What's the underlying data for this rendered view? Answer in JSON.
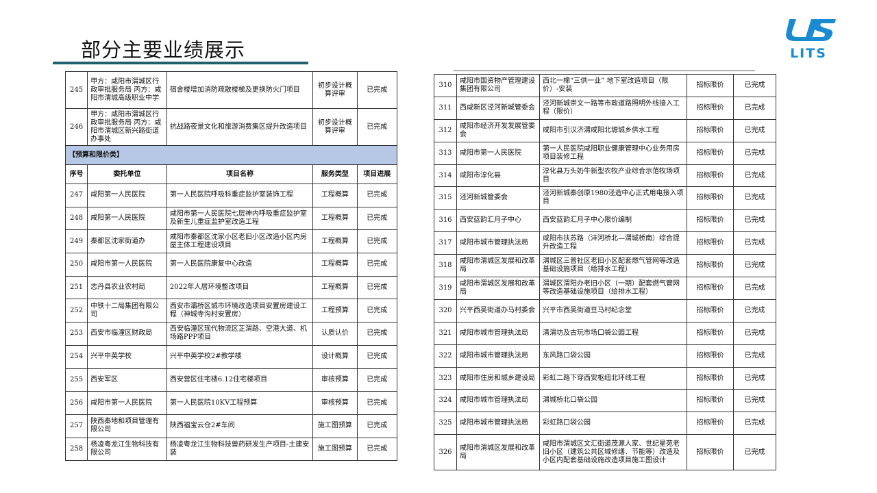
{
  "header": {
    "title": "部分主要业绩展示"
  },
  "logo": {
    "name": "lits-logo",
    "text": "LITS",
    "color": "#1a8bd0"
  },
  "left_table": {
    "top_rows": [
      {
        "no": "245",
        "unit": "甲方：咸阳市渭城区行政审批服务局\n丙方：咸阳市渭城高级职业中学",
        "project": "宿舍楼增加消防疏散楼梯及更换防火门项目",
        "service": "初步设计概算评审",
        "status": "已完成"
      },
      {
        "no": "246",
        "unit": "甲方：咸阳市渭城区行政审批服务局\n丙方：咸阳市渭城区新兴路街道办事处",
        "project": "抗战路夜景文化和旅游消费集区提升改造项目",
        "service": "初步设计概算评审",
        "status": "已完成"
      }
    ],
    "section_label": "【预算和限价类】",
    "headers": {
      "no": "序号",
      "unit": "委托单位",
      "project": "项目名称",
      "service": "服务类型",
      "status": "项目进展"
    },
    "rows": [
      {
        "no": "247",
        "unit": "咸阳第一人民医院",
        "project": "第一人民医院呼吸科重症监护室装饰工程",
        "service": "工程概算",
        "status": "已完成"
      },
      {
        "no": "248",
        "unit": "咸阳第一人民医院",
        "project": "咸阳市第一人民医院七层神内呼吸重症监护室及新生儿重症监护室改造工程",
        "service": "工程概算",
        "status": "已完成"
      },
      {
        "no": "249",
        "unit": "秦都区沈家街道办",
        "project": "咸阳市秦都区沈家小区老旧小区改造小区内房屋主体工程建设项目",
        "service": "工程概算",
        "status": "已完成"
      },
      {
        "no": "250",
        "unit": "咸阳市第一人民医院",
        "project": "第一人民医院康复中心改造",
        "service": "工程概算",
        "status": "已完成"
      },
      {
        "no": "251",
        "unit": "志丹县农业农村局",
        "project": "2022年人居环境整改项目",
        "service": "工程概算",
        "status": "已完成"
      },
      {
        "no": "252",
        "unit": "中铁十二局集团有限公司",
        "project": "西安市灞桥区城市环境改造项目安置房建设工程（神城寺沟村安置房）",
        "service": "工程预算",
        "status": "已完成"
      },
      {
        "no": "253",
        "unit": "西安市临潼区财政局",
        "project": "西安临潼区现代物流区芷渭路、空港大道、机场路PPP项目",
        "service": "认质认价",
        "status": "已完成"
      },
      {
        "no": "254",
        "unit": "兴平中英学校",
        "project": "兴平中英学校2#教学楼",
        "service": "设计概算",
        "status": "已完成"
      },
      {
        "no": "255",
        "unit": "西安军区",
        "project": "西安营区住宅楼6.12住宅楼项目",
        "service": "审核预算",
        "status": "已完成"
      },
      {
        "no": "256",
        "unit": "咸阳市第一人民医院",
        "project": "第一人民医院10KV工程预算",
        "service": "审核预算",
        "status": "已完成"
      },
      {
        "no": "257",
        "unit": "陕西秦地和项目管理有限公司",
        "project": "陕西福宝云仓2#车间",
        "service": "施工图预算",
        "status": "已完成"
      },
      {
        "no": "258",
        "unit": "杨凌粤龙江生物科技有限公司",
        "project": "杨凌粤龙江生物科技兽药研发生产项目-土建安装",
        "service": "施工图预算",
        "status": "已完成"
      }
    ]
  },
  "right_table": {
    "rows": [
      {
        "no": "310",
        "unit": "咸阳市国资物产管理建设集团有限公司",
        "project": "西北一棉“三供一业” 地下室改造项目（限价）-安装",
        "service": "招标限价",
        "status": "已完成"
      },
      {
        "no": "311",
        "unit": "西咸新区泾河新城管委会",
        "project": "泾河新城崇文一路等市政道路照明外线接入工程（限价）",
        "service": "招标限价",
        "status": "已完成"
      },
      {
        "no": "312",
        "unit": "咸阳市经济开发发展管委会",
        "project": "咸阳市引汉济渭咸阳北塬城乡供水工程",
        "service": "招标限价",
        "status": "已完成"
      },
      {
        "no": "313",
        "unit": "咸阳市第一人民医院",
        "project": "第一人民医院咸阳职业健康管理中心业务用房项目装修工程",
        "service": "招标限价",
        "status": "已完成"
      },
      {
        "no": "314",
        "unit": "咸阳市淳化县",
        "project": "淳化县万头奶牛新型农牧产业综合示范牧场项目",
        "service": "招标限价",
        "status": "已完成"
      },
      {
        "no": "315",
        "unit": "泾河新城管委会",
        "project": "泾河新城秦创原1980泾造中心正式用电接入项目",
        "service": "招标限价",
        "status": "已完成"
      },
      {
        "no": "316",
        "unit": "西安蓝韵汇月子中心",
        "project": "西安蓝韵汇月子中心限价编制",
        "service": "招标限价",
        "status": "已完成"
      },
      {
        "no": "317",
        "unit": "咸阳市城市管理执法局",
        "project": "咸阳市扶苏路（沣河桥北—渭城桥南）综合提升改造工程",
        "service": "招标限价",
        "status": "已完成"
      },
      {
        "no": "318",
        "unit": "咸阳市渭城区发展和改革局",
        "project": "渭城区三普社区老旧小区配套燃气管网等改造基础设施项目（给排水工程）",
        "service": "招标限价",
        "status": "已完成"
      },
      {
        "no": "319",
        "unit": "咸阳市渭城区发展和改革局",
        "project": "渭城区渭阳办老旧小区（一期）配套燃气管网等改造基础设施项目（给排水工程）",
        "service": "招标限价",
        "status": "已完成"
      },
      {
        "no": "320",
        "unit": "兴平西吴街道办马村委会",
        "project": "兴平市西吴街道豆马村纪念堂",
        "service": "招标限价",
        "status": "已完成"
      },
      {
        "no": "321",
        "unit": "咸阳市城市管理执法局",
        "project": "清渭坊及古玩市场口袋公园工程",
        "service": "招标限价",
        "status": "已完成"
      },
      {
        "no": "322",
        "unit": "咸阳市城市管理执法局",
        "project": "东风路口袋公园",
        "service": "招标限价",
        "status": "已完成"
      },
      {
        "no": "323",
        "unit": "咸阳市住房和城乡建设局",
        "project": "彩虹二路下穿西安枢纽北环线工程",
        "service": "招标限价",
        "status": "已完成"
      },
      {
        "no": "324",
        "unit": "咸阳市城市管理执法局",
        "project": "渭城桥北口袋公园",
        "service": "招标限价",
        "status": "已完成"
      },
      {
        "no": "325",
        "unit": "咸阳市城市管理执法局",
        "project": "彩虹路口袋公园",
        "service": "招标限价",
        "status": "已完成"
      },
      {
        "no": "326",
        "unit": "咸阳市渭城区发展和改革局",
        "project": "咸阳市渭城区文汇街道茂源人家、世纪星苑老旧小区（建筑公共区域修缮、节能等）改造及小区内配套基础设施改造项目施工图设计",
        "service": "招标限价",
        "status": "已完成"
      }
    ]
  }
}
